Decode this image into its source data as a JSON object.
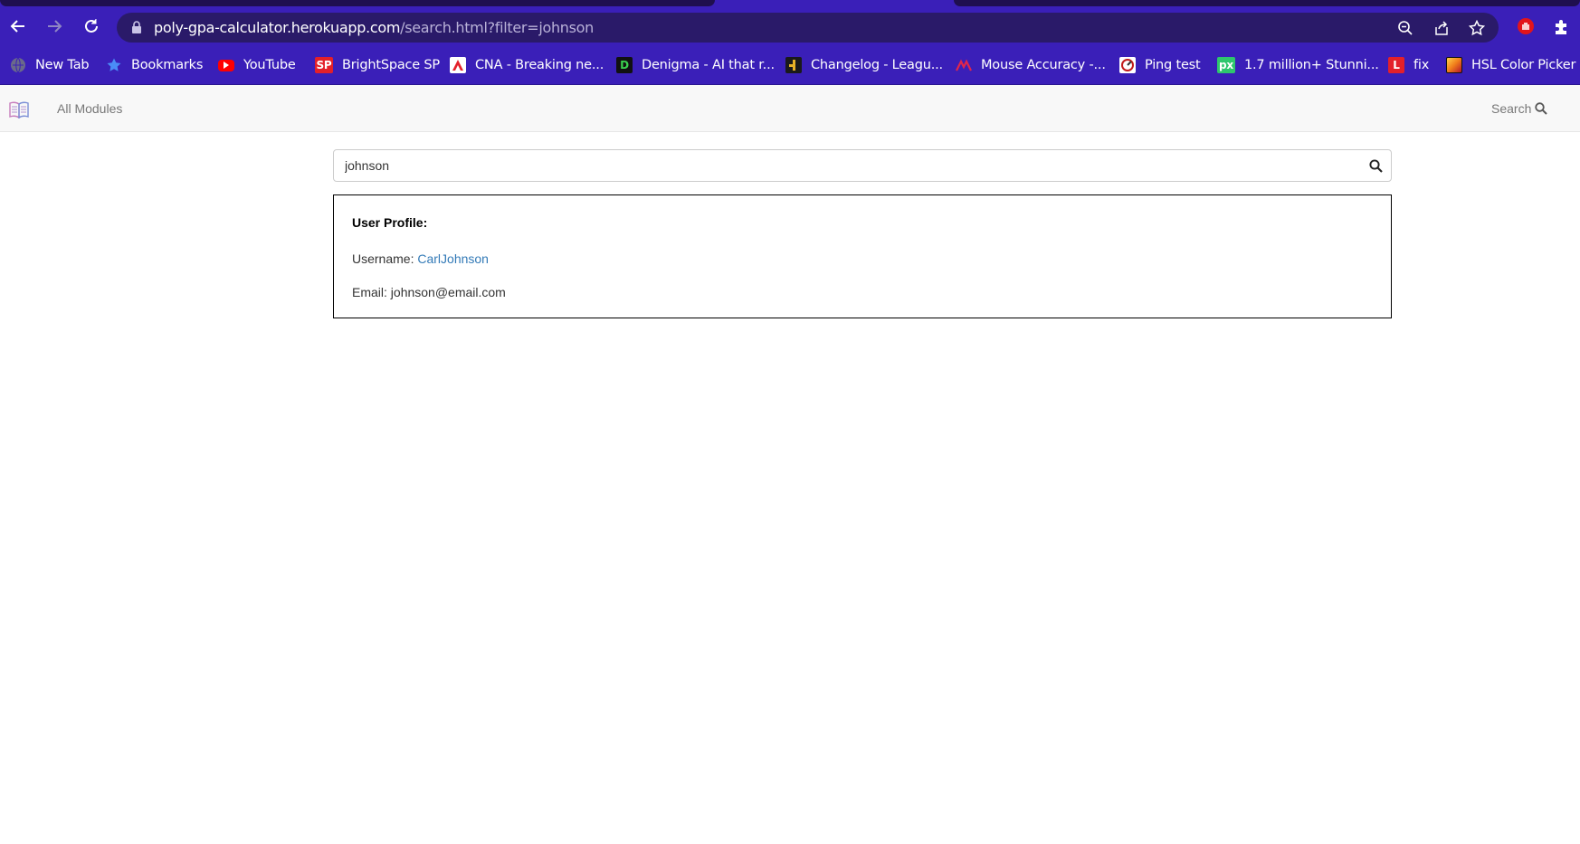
{
  "browser": {
    "url_host": "poly-gpa-calculator.herokuapp.com",
    "url_path": "/search.html?filter=johnson",
    "toolbar_icons": [
      "back-icon",
      "forward-icon",
      "reload-icon",
      "lock-icon",
      "zoom-out-icon",
      "share-icon",
      "star-icon",
      "extension-stop-icon",
      "puzzle-icon"
    ]
  },
  "bookmarks": [
    {
      "label": "New Tab",
      "icon": "globe-icon"
    },
    {
      "label": "Bookmarks",
      "icon": "star-icon"
    },
    {
      "label": "YouTube",
      "icon": "youtube-icon"
    },
    {
      "label": "BrightSpace SP",
      "icon": "sp-icon",
      "icon_text": "SP"
    },
    {
      "label": "CNA - Breaking ne...",
      "icon": "cna-icon"
    },
    {
      "label": "Denigma - AI that r...",
      "icon": "denigma-icon",
      "icon_text": "D"
    },
    {
      "label": "Changelog - Leagu...",
      "icon": "changelog-icon"
    },
    {
      "label": "Mouse Accuracy -...",
      "icon": "mouse-accuracy-icon"
    },
    {
      "label": "Ping test",
      "icon": "ping-icon"
    },
    {
      "label": "1.7 million+ Stunni...",
      "icon": "pixabay-icon",
      "icon_text": "px"
    },
    {
      "label": "fix",
      "icon": "l-icon",
      "icon_text": "L"
    },
    {
      "label": "HSL Color Picker -...",
      "icon": "color-picker-icon"
    }
  ],
  "navbar": {
    "modules_label": "All Modules",
    "search_label": "Search"
  },
  "search": {
    "value": "johnson"
  },
  "profile": {
    "title": "User Profile:",
    "username_label": "Username:",
    "username_value": "CarlJohnson",
    "email_label": "Email:",
    "email_value": "johnson@email.com"
  },
  "colors": {
    "browser_chrome": "#3a1fb8",
    "omnibox": "#2a1a69",
    "link": "#337ab7",
    "navbar_bg": "#f8f8f8"
  }
}
